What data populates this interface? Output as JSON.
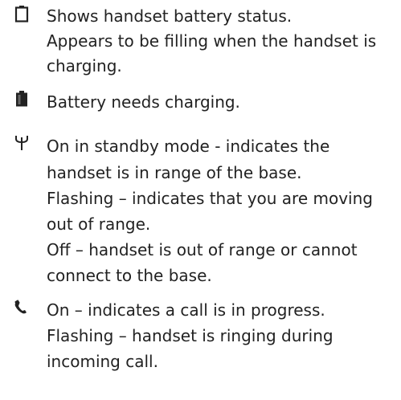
{
  "legend": {
    "items": [
      {
        "icon": "battery-outline-icon",
        "lines": [
          "Shows handset battery status.",
          "Appears to be filling when the handset is",
          "charging."
        ]
      },
      {
        "icon": "battery-low-icon",
        "lines": [
          "Battery needs charging."
        ]
      },
      {
        "icon": "antenna-signal-icon",
        "lines": [
          "On in standby mode - indicates the",
          "handset is in range of the base.",
          "Flashing – indicates that you are moving",
          "out of range.",
          "Off – handset is out of range or cannot",
          "connect to the base."
        ]
      },
      {
        "icon": "phone-handset-icon",
        "lines": [
          "On – indicates a call is in progress.",
          "Flashing – handset is ringing during",
          "incoming call."
        ]
      }
    ]
  }
}
